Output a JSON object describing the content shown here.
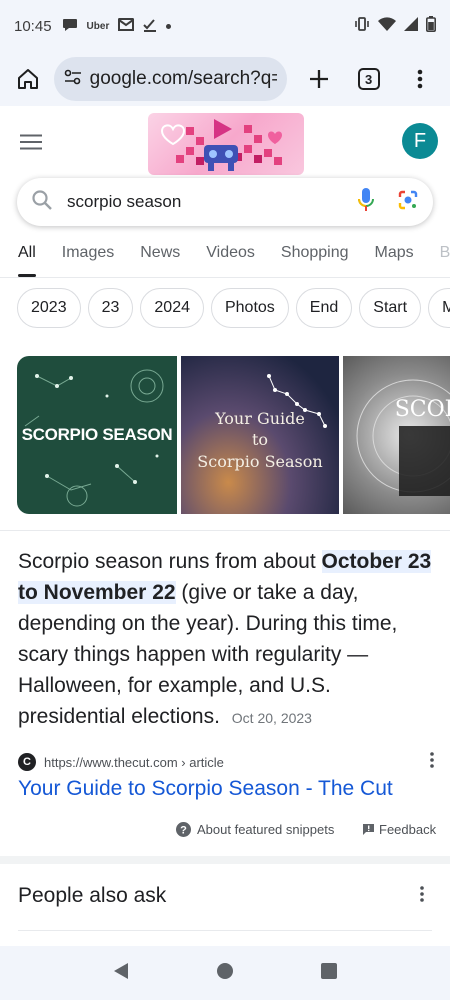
{
  "status_bar": {
    "time": "10:45",
    "left_icons": [
      "chat-icon",
      "uber-icon",
      "gmail-icon",
      "task-icon",
      "dot-icon"
    ],
    "uber_label": "Uber",
    "right_icons": [
      "vibrate-icon",
      "wifi-icon",
      "signal-icon",
      "battery-icon"
    ]
  },
  "browser": {
    "url": "google.com/search?q=sc",
    "tab_count": "3"
  },
  "google": {
    "avatar_letter": "F",
    "search_query": "scorpio season",
    "tabs": [
      {
        "label": "All",
        "active": true
      },
      {
        "label": "Images"
      },
      {
        "label": "News"
      },
      {
        "label": "Videos"
      },
      {
        "label": "Shopping"
      },
      {
        "label": "Maps"
      },
      {
        "label": "B"
      }
    ],
    "chips": [
      "2023",
      "23",
      "2024",
      "Photos",
      "End",
      "Start",
      "Mer"
    ]
  },
  "images": {
    "img1_text": "SCORPIO SEASON",
    "img2_line1": "Your Guide",
    "img2_line2": "to",
    "img2_line3": "Scorpio Season",
    "img3_text": "SCOR"
  },
  "snippet": {
    "text_before": "Scorpio season runs from about ",
    "highlight": "October 23 to November 22",
    "text_after": " (give or take a day, depending on the year). During this time, scary things happen with regularity — Halloween, for example, and U.S. presidential elections.",
    "date": "Oct 20, 2023",
    "source_url": "https://www.thecut.com › article",
    "favicon_letter": "C",
    "title": "Your Guide to Scorpio Season - The Cut",
    "about_label": "About featured snippets",
    "feedback_label": "Feedback"
  },
  "people_also_ask": {
    "heading": "People also ask"
  },
  "colors": {
    "link": "#1558d6",
    "highlight_bg": "#e8f0fe",
    "avatar_bg": "#0b8a94",
    "chrome_bg": "#f2f5fb"
  }
}
